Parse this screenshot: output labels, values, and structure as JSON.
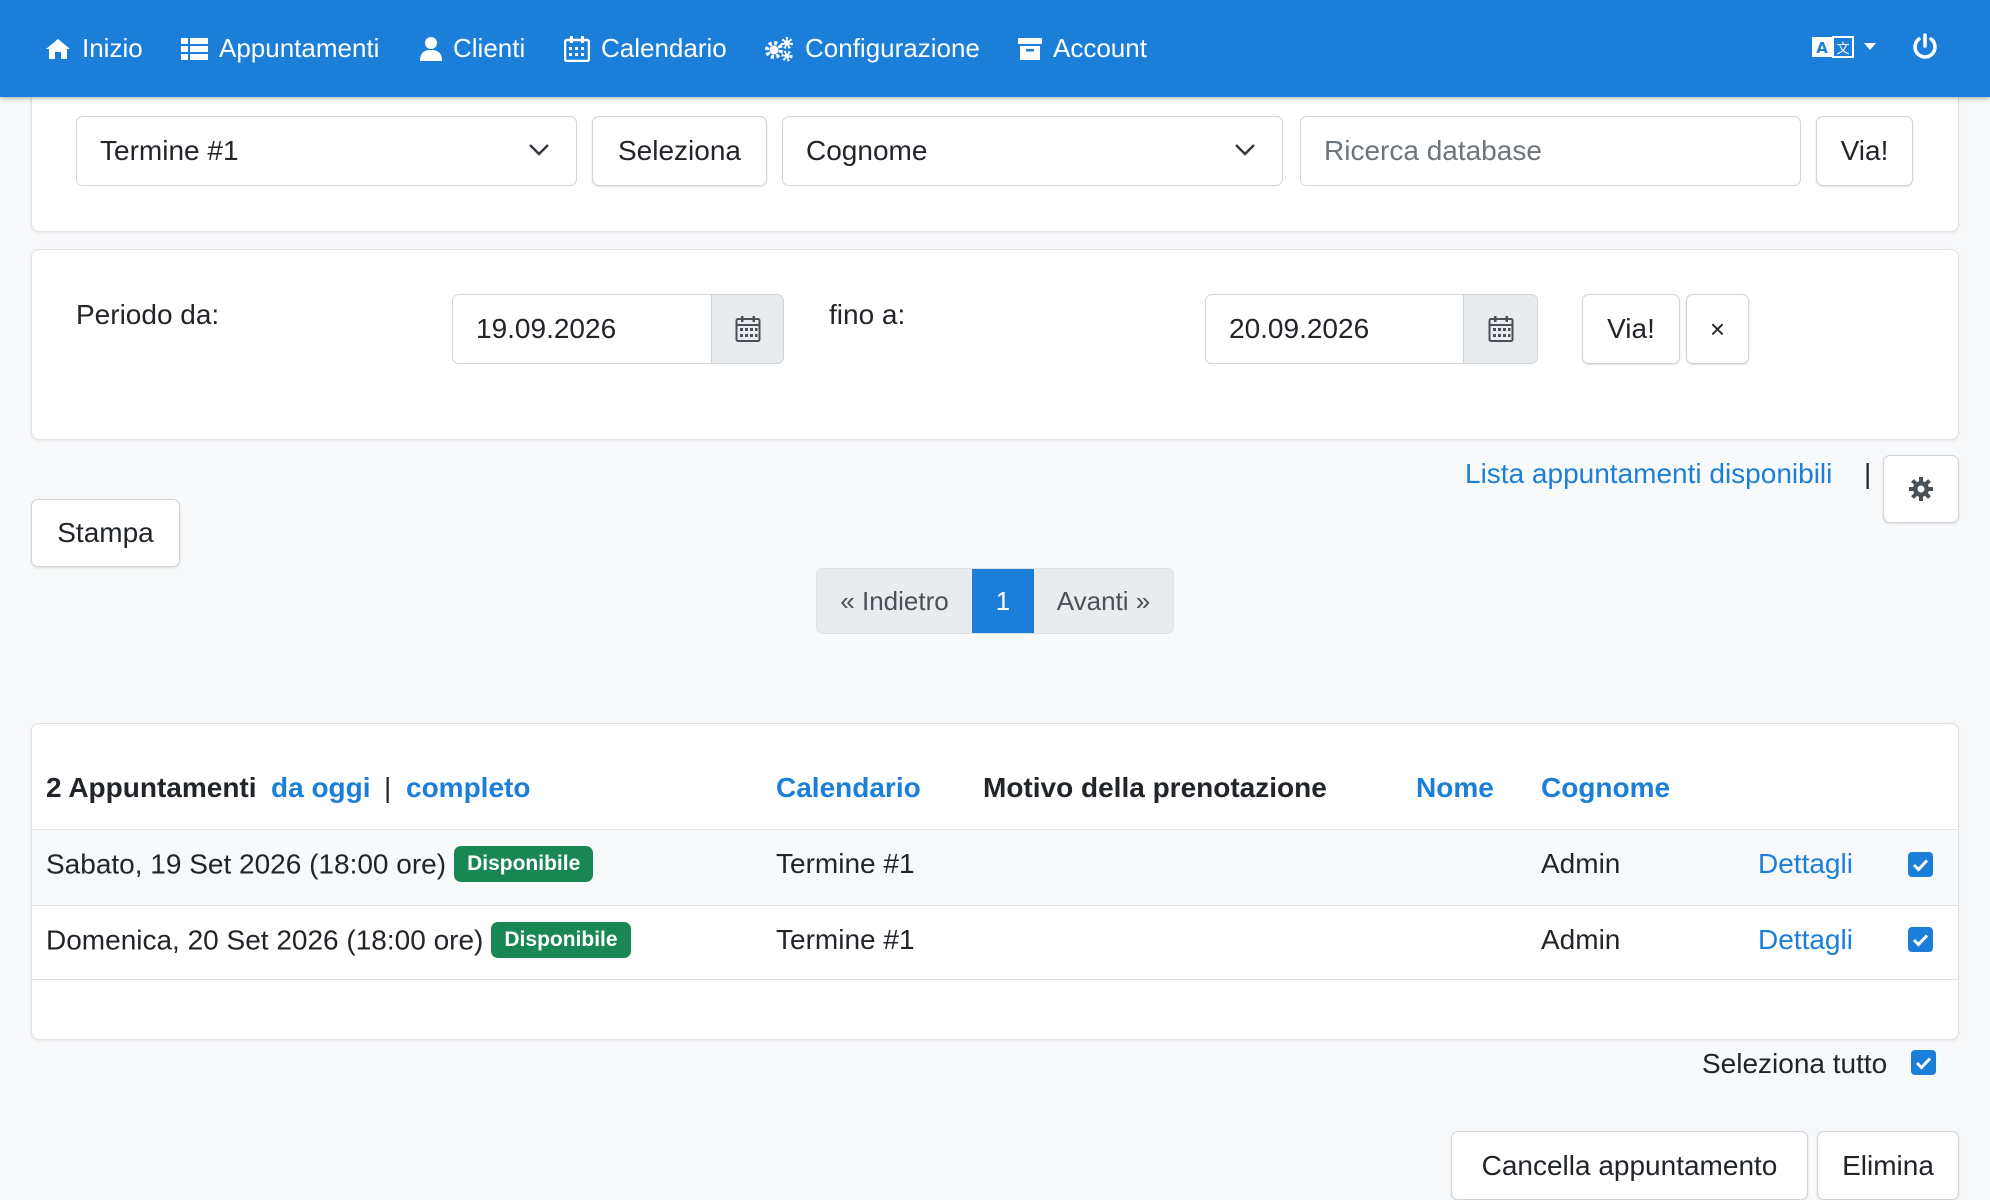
{
  "nav": {
    "items": [
      {
        "label": "Inizio",
        "icon": "home-icon"
      },
      {
        "label": "Appuntamenti",
        "icon": "list-icon"
      },
      {
        "label": "Clienti",
        "icon": "user-icon"
      },
      {
        "label": "Calendario",
        "icon": "calendar-icon"
      },
      {
        "label": "Configurazione",
        "icon": "gears-icon"
      },
      {
        "label": "Account",
        "icon": "archive-icon"
      }
    ],
    "language_icon": "translate-icon",
    "power_icon": "power-icon"
  },
  "filter": {
    "calendar_select": "Termine #1",
    "select_button": "Seleziona",
    "field_select": "Cognome",
    "search_placeholder": "Ricerca database",
    "go_button": "Via!"
  },
  "period": {
    "from_label": "Periodo da:",
    "from_value": "19.09.2026",
    "to_label": "fino a:",
    "to_value": "20.09.2026",
    "go_button": "Via!",
    "clear_button": "×"
  },
  "actions": {
    "available_link": "Lista appuntamenti disponibili",
    "separator": "|",
    "print_button": "Stampa"
  },
  "pagination": {
    "prev": "« Indietro",
    "current": "1",
    "next": "Avanti »"
  },
  "table": {
    "count_label": "2 Appuntamenti",
    "from_today": "da oggi",
    "sep": "|",
    "complete": "completo",
    "headers": {
      "calendar": "Calendario",
      "reason": "Motivo della prenotazione",
      "first_name": "Nome",
      "last_name": "Cognome"
    },
    "rows": [
      {
        "date": "Sabato, 19 Set 2026 (18:00 ore)",
        "status": "Disponibile",
        "calendar": "Termine #1",
        "last_name": "Admin",
        "details": "Dettagli",
        "checked": true
      },
      {
        "date": "Domenica, 20 Set 2026 (18:00 ore)",
        "status": "Disponibile",
        "calendar": "Termine #1",
        "last_name": "Admin",
        "details": "Dettagli",
        "checked": true
      }
    ]
  },
  "footer": {
    "select_all": "Seleziona tutto",
    "cancel_button": "Cancella appuntamento",
    "delete_button": "Elimina"
  },
  "colors": {
    "primary": "#1b7fd9",
    "success": "#198754"
  }
}
